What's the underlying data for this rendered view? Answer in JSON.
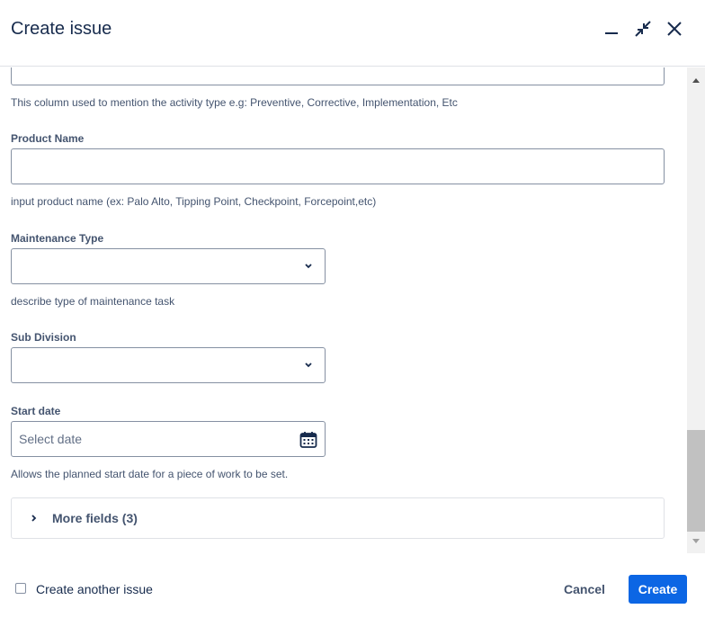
{
  "dialog": {
    "title": "Create issue",
    "actions": {
      "minimize_icon": "minimize-icon",
      "collapse_icon": "collapse-icon",
      "close_icon": "close-icon"
    }
  },
  "fields": {
    "activity_type": {
      "value": "",
      "help": "This column used to mention the activity type e.g: Preventive, Corrective, Implementation, Etc"
    },
    "product_name": {
      "label": "Product Name",
      "value": "",
      "help": "input product name (ex: Palo Alto, Tipping Point, Checkpoint, Forcepoint,etc)"
    },
    "maintenance_type": {
      "label": "Maintenance Type",
      "selected": "",
      "help": "describe type of maintenance task"
    },
    "sub_division": {
      "label": "Sub Division",
      "selected": ""
    },
    "start_date": {
      "label": "Start date",
      "placeholder": "Select date",
      "help": "Allows the planned start date for a piece of work to be set."
    }
  },
  "more_fields": {
    "label": "More fields (3)"
  },
  "footer": {
    "create_another_label": "Create another issue",
    "create_another_checked": false,
    "cancel_label": "Cancel",
    "create_label": "Create"
  },
  "colors": {
    "primary": "#0c66e4",
    "text": "#172b4d",
    "subtle_text": "#44546f",
    "border": "#8590a2"
  }
}
